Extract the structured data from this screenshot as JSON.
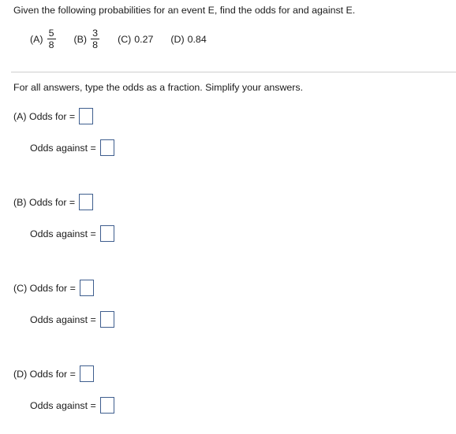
{
  "question": {
    "prompt": "Given the following probabilities for an event E, find the odds for and against E."
  },
  "choices": [
    {
      "label": "(A)",
      "type": "fraction",
      "numerator": "5",
      "denominator": "8",
      "value": "5/8"
    },
    {
      "label": "(B)",
      "type": "fraction",
      "numerator": "3",
      "denominator": "8",
      "value": "3/8"
    },
    {
      "label": "(C)",
      "type": "decimal",
      "value": "0.27"
    },
    {
      "label": "(D)",
      "type": "decimal",
      "value": "0.84"
    }
  ],
  "instruction": {
    "text": "For all answers, type the odds as a fraction. Simplify your answers."
  },
  "answer_groups": [
    {
      "key": "A",
      "for_label": "(A) Odds for =",
      "for_value": "",
      "against_label": "Odds against =",
      "against_value": ""
    },
    {
      "key": "B",
      "for_label": "(B) Odds for =",
      "for_value": "",
      "against_label": "Odds against =",
      "against_value": ""
    },
    {
      "key": "C",
      "for_label": "(C) Odds for =",
      "for_value": "",
      "against_label": "Odds against =",
      "against_value": ""
    },
    {
      "key": "D",
      "for_label": "(D) Odds for =",
      "for_value": "",
      "against_label": "Odds against =",
      "against_value": ""
    }
  ],
  "style": {
    "input_border_color": "#3f5e8e",
    "divider_color": "#cfcfcf",
    "text_color": "#1b1b1b",
    "background_color": "#ffffff"
  }
}
